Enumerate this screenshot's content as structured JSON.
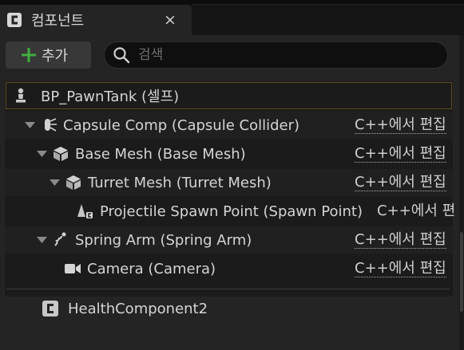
{
  "tab": {
    "title": "컴포넌트",
    "close_glyph": "×"
  },
  "toolbar": {
    "add_label": "추가",
    "search_placeholder": "검색"
  },
  "tree": {
    "root": {
      "label": "BP_PawnTank (셀프)"
    },
    "items": [
      {
        "label": "Capsule Comp (Capsule Collider)",
        "link": "C++에서 편집",
        "icon": "capsule-collider-icon"
      },
      {
        "label": "Base Mesh (Base Mesh)",
        "link": "C++에서 편집",
        "icon": "static-mesh-icon"
      },
      {
        "label": "Turret Mesh (Turret Mesh)",
        "link": "C++에서 편집",
        "icon": "static-mesh-icon"
      },
      {
        "label": "Projectile Spawn Point (Spawn Point)",
        "link": "C++에서 편",
        "icon": "scene-component-icon"
      },
      {
        "label": "Spring Arm (Spring Arm)",
        "link": "C++에서 편집",
        "icon": "spring-arm-icon"
      },
      {
        "label": "Camera (Camera)",
        "link": "C++에서 편집",
        "icon": "camera-icon"
      }
    ]
  },
  "component_list": {
    "items": [
      {
        "label": "HealthComponent2",
        "icon": "cpp-class-icon"
      }
    ]
  },
  "colors": {
    "panel_bg": "#242424",
    "tree_bg": "#1b1b1b",
    "root_border": "#5c4a22",
    "add_green": "#3fae3f",
    "text": "#d4d4d4"
  }
}
